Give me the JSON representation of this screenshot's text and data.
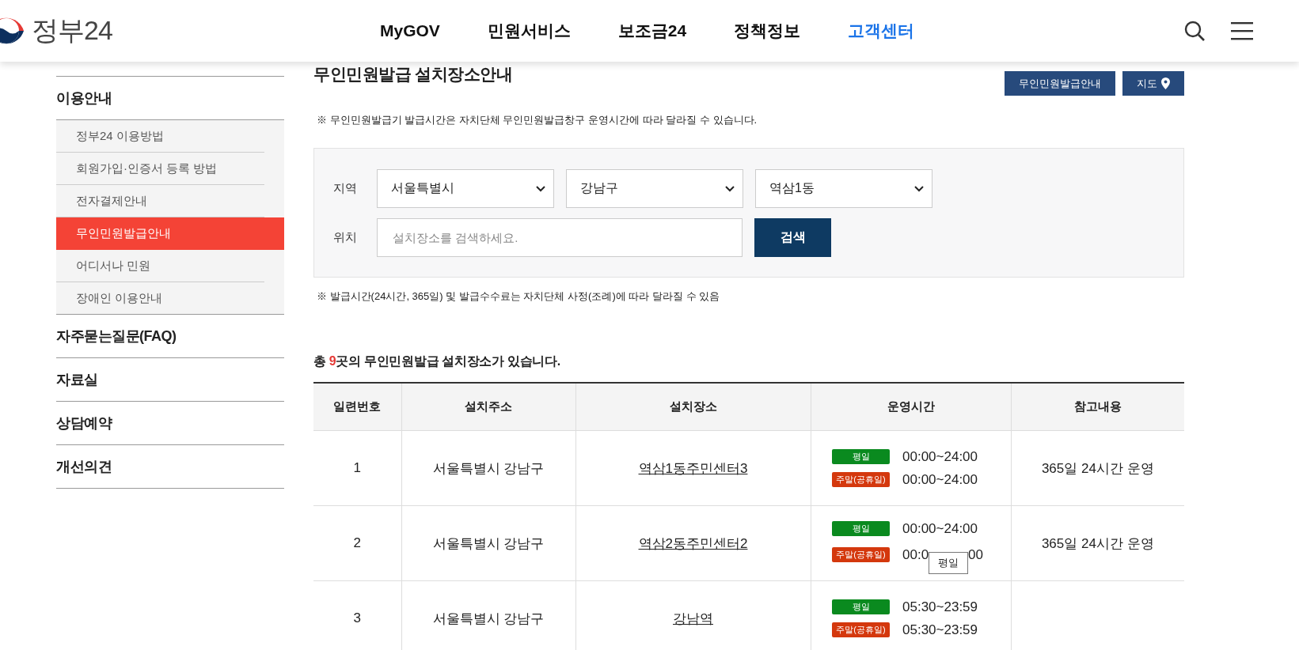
{
  "header": {
    "logo": "정부24",
    "nav": [
      {
        "label": "MyGOV",
        "selected": false
      },
      {
        "label": "민원서비스",
        "selected": false
      },
      {
        "label": "보조금24",
        "selected": false
      },
      {
        "label": "정책정보",
        "selected": false
      },
      {
        "label": "고객센터",
        "selected": true
      }
    ]
  },
  "sidebar": {
    "items": [
      {
        "label": "이용안내",
        "children": [
          {
            "label": "정부24 이용방법",
            "selected": false
          },
          {
            "label": "회원가입·인증서 등록 방법",
            "selected": false
          },
          {
            "label": "전자결제안내",
            "selected": false
          },
          {
            "label": "무인민원발급안내",
            "selected": true
          },
          {
            "label": "어디서나 민원",
            "selected": false
          },
          {
            "label": "장애인 이용안내",
            "selected": false
          }
        ]
      },
      {
        "label": "자주묻는질문(FAQ)"
      },
      {
        "label": "자료실"
      },
      {
        "label": "상담예약"
      },
      {
        "label": "개선의견"
      }
    ]
  },
  "page": {
    "title": "무인민원발급 설치장소안내",
    "buttons": [
      {
        "label": "무인민원발급안내",
        "kind": "plain"
      },
      {
        "label": "지도",
        "kind": "map"
      }
    ],
    "notice": "※ 무인민원발급기 발급시간은 자치단체 무인민원발급창구 운영시간에 따라 달라질 수 있습니다."
  },
  "search": {
    "region_label": "지역",
    "selects": [
      "서울특별시",
      "강남구",
      "역삼1동"
    ],
    "location_label": "위치",
    "placeholder": "설치장소를 검색하세요.",
    "button": "검색"
  },
  "search_notice": "※ 발급시간(24시간, 365일) 및 발급수수료는 자치단체 사정(조례)에 따라 달라질 수 있음",
  "summary": {
    "prefix": "총 ",
    "count": "9",
    "suffix": "곳의 무인민원발급 설치장소가 있습니다."
  },
  "table": {
    "columns": [
      "일련번호",
      "설치주소",
      "설치장소",
      "운영시간",
      "참고내용"
    ],
    "rows": [
      {
        "number": "1",
        "address": "서울특별시 강남구",
        "place": "역삼1동주민센터3",
        "hours": [
          {
            "kind": "weekday",
            "label": "평일",
            "time": "00:00~24:00"
          },
          {
            "kind": "weekend",
            "label": "주말(공휴일)",
            "time": "00:00~24:00"
          }
        ],
        "note": "365일 24시간 운영"
      },
      {
        "number": "2",
        "address": "서울특별시 강남구",
        "place": "역삼2동주민센터2",
        "hours": [
          {
            "kind": "weekday",
            "label": "평일",
            "time": "00:00~24:00"
          },
          {
            "kind": "weekend",
            "label": "주말(공휴일)",
            "time": "00:0",
            "time_end": "00"
          }
        ],
        "note": "365일 24시간 운영"
      },
      {
        "number": "3",
        "address": "서울특별시 강남구",
        "place": "강남역",
        "hours": [
          {
            "kind": "weekday",
            "label": "평일",
            "time": "05:30~23:59"
          },
          {
            "kind": "weekend",
            "label": "주말(공휴일)",
            "time": "05:30~23:59"
          }
        ]
      }
    ]
  },
  "tooltip": "평일"
}
